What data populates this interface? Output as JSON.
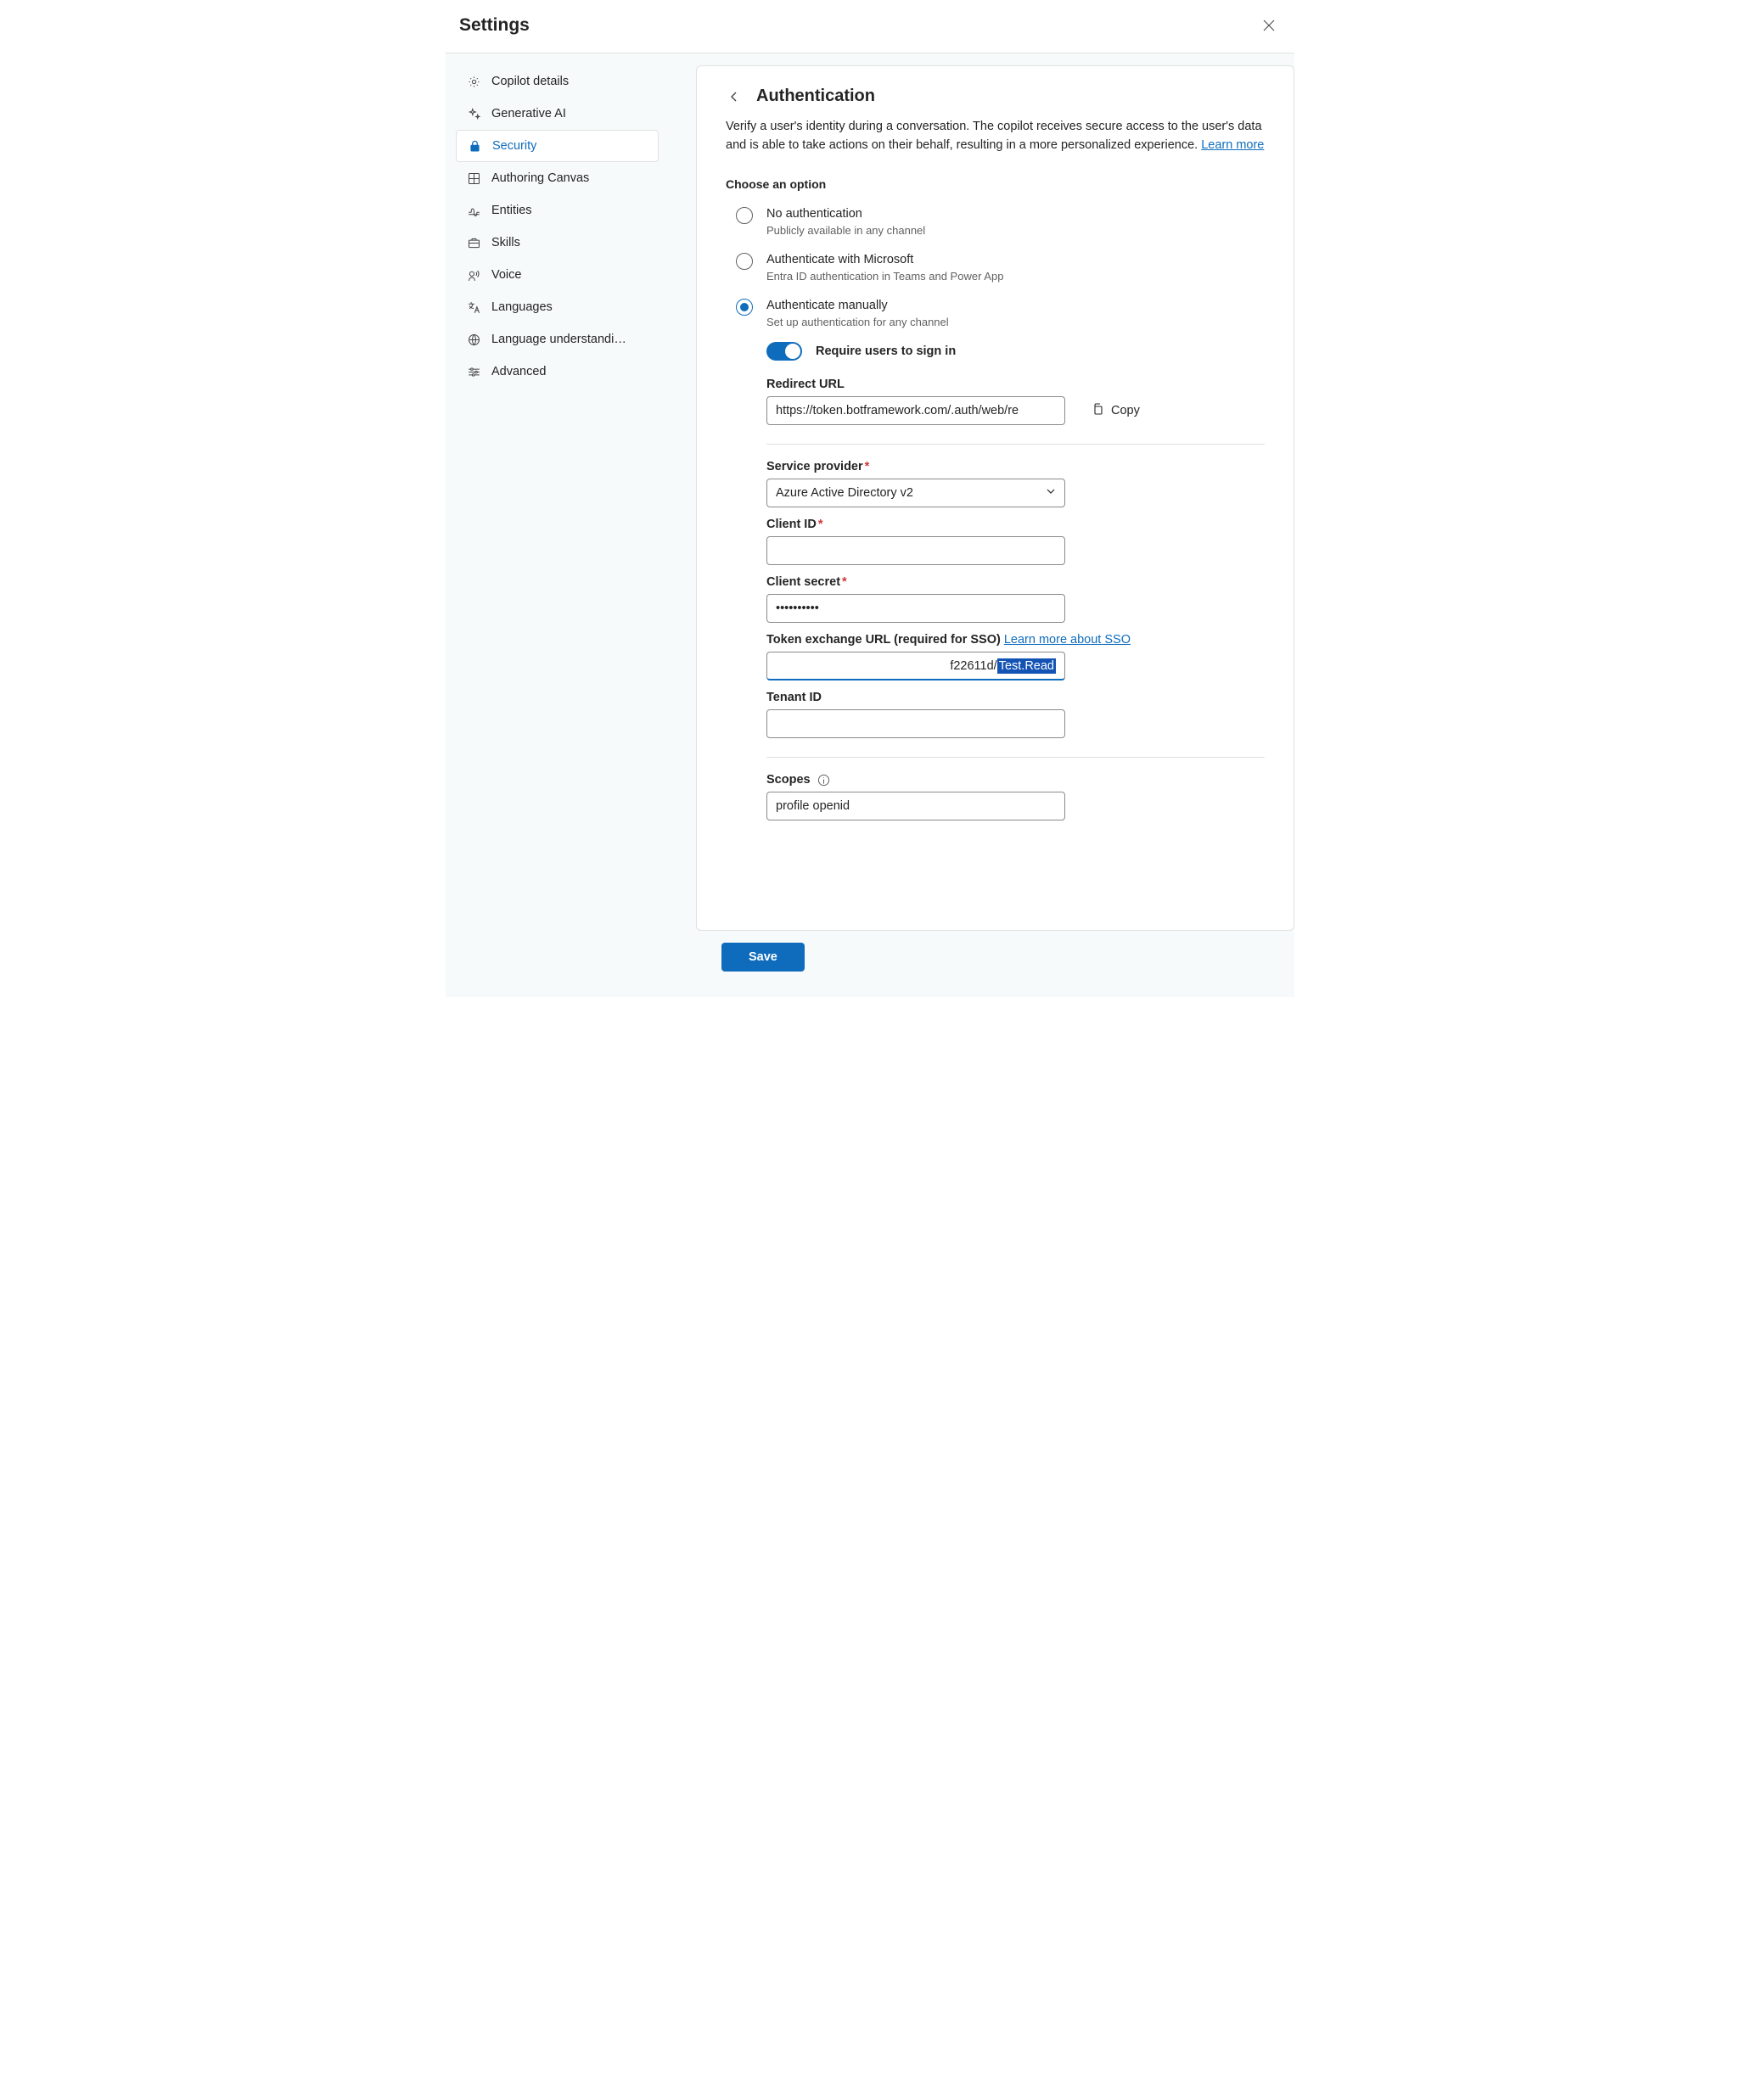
{
  "header": {
    "title": "Settings"
  },
  "sidebar": {
    "items": [
      {
        "label": "Copilot details"
      },
      {
        "label": "Generative AI"
      },
      {
        "label": "Security"
      },
      {
        "label": "Authoring Canvas"
      },
      {
        "label": "Entities"
      },
      {
        "label": "Skills"
      },
      {
        "label": "Voice"
      },
      {
        "label": "Languages"
      },
      {
        "label": "Language understandi…"
      },
      {
        "label": "Advanced"
      }
    ]
  },
  "main": {
    "title": "Authentication",
    "description": "Verify a user's identity during a conversation. The copilot receives secure access to the user's data and is able to take actions on their behalf, resulting in a more personalized experience. ",
    "learn_more": "Learn more",
    "choose_option_title": "Choose an option",
    "options": [
      {
        "label": "No authentication",
        "sub": "Publicly available in any channel"
      },
      {
        "label": "Authenticate with Microsoft",
        "sub": "Entra ID authentication in Teams and Power App"
      },
      {
        "label": "Authenticate manually",
        "sub": "Set up authentication for any channel"
      }
    ],
    "require_signin": "Require users to sign in",
    "fields": {
      "redirect_label": "Redirect URL",
      "redirect_value": "https://token.botframework.com/.auth/web/re",
      "copy_label": "Copy",
      "service_provider_label": "Service provider",
      "service_provider_value": "Azure Active Directory v2",
      "client_id_label": "Client ID",
      "client_id_value": "",
      "client_secret_label": "Client secret",
      "client_secret_value": "••••••••••",
      "token_exchange_label": "Token exchange URL (required for SSO) ",
      "token_exchange_link": "Learn more about SSO",
      "token_prefix": "f22611d/",
      "token_selected": "Test.Read",
      "tenant_id_label": "Tenant ID",
      "tenant_id_value": "",
      "scopes_label": "Scopes",
      "scopes_value": "profile openid"
    }
  },
  "footer": {
    "save_label": "Save"
  }
}
